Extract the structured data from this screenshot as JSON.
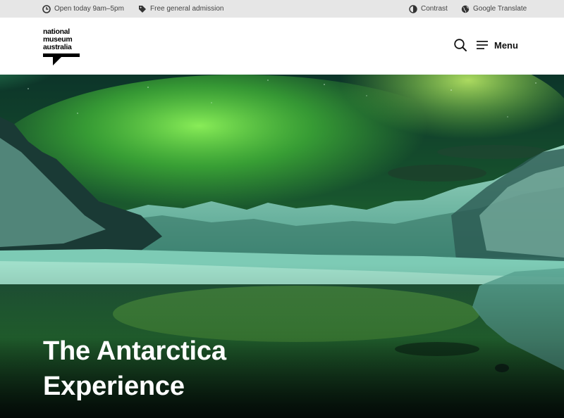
{
  "utility_bar": {
    "hours": {
      "icon": "clock-icon",
      "label": "Open today 9am–5pm"
    },
    "admission": {
      "icon": "tag-icon",
      "label": "Free general admission"
    },
    "contrast": {
      "icon": "contrast-icon",
      "label": "Contrast"
    },
    "translate": {
      "icon": "globe-icon",
      "label": "Google Translate"
    }
  },
  "header": {
    "logo": {
      "line1": "national",
      "line2": "museum",
      "line3": "australia"
    },
    "search": {
      "icon": "search-icon"
    },
    "menu": {
      "icon": "hamburger-icon",
      "label": "Menu"
    }
  },
  "hero": {
    "image": "aurora-over-snowy-mountains-and-lake",
    "title_line1": "The Antarctica",
    "title_line2": "Experience"
  },
  "colors": {
    "utility_bg": "#e6e6e6",
    "aurora_green": "#5fd84a",
    "text_white": "#ffffff"
  }
}
